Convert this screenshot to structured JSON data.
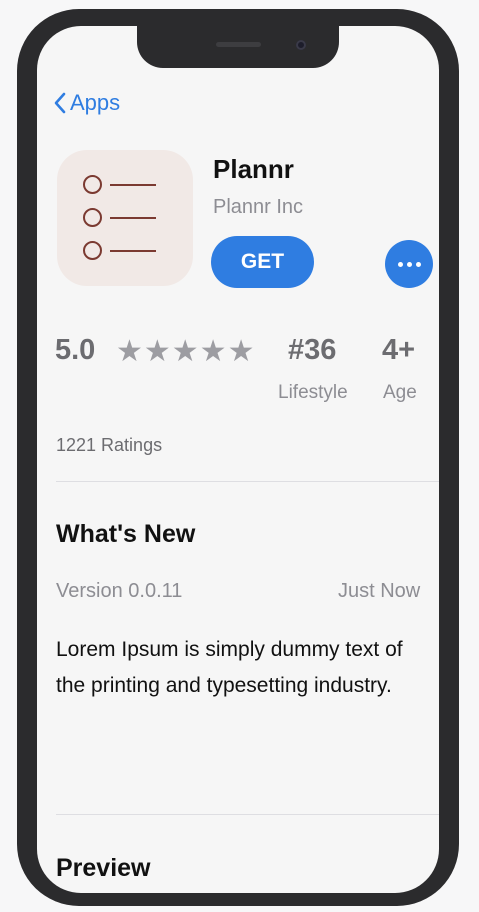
{
  "nav": {
    "back_label": "Apps"
  },
  "app": {
    "name": "Plannr",
    "developer": "Plannr Inc",
    "get_label": "GET",
    "more_icon": "ellipsis-icon"
  },
  "stats": {
    "rating": "5.0",
    "stars": "★★★★★",
    "star_count": 5,
    "rank": "#36",
    "rank_category": "Lifestyle",
    "age": "4+",
    "age_label": "Age",
    "ratings_count": "1221 Ratings"
  },
  "whats_new": {
    "title": "What's New",
    "version": "Version 0.0.11",
    "time": "Just Now",
    "description": "Lorem Ipsum is simply dummy text of the printing and typesetting industry."
  },
  "preview": {
    "title": "Preview"
  },
  "colors": {
    "accent": "#2f7de1",
    "phone_frame": "#2b2b2d",
    "screen_bg": "#f6f6f6",
    "icon_bg": "#f1e9e6",
    "icon_fg": "#7b3a31"
  }
}
